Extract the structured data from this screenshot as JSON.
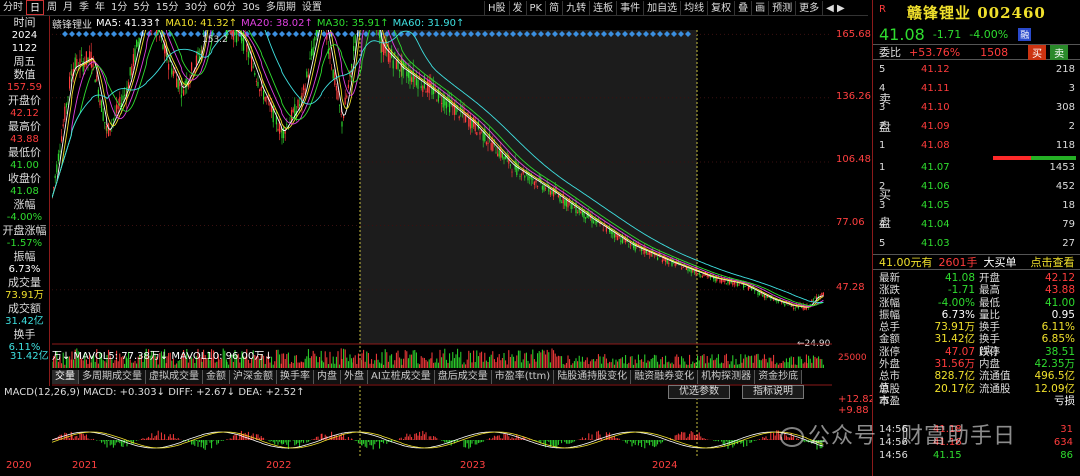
{
  "topbar": {
    "items": [
      "分时",
      "日",
      "周",
      "月",
      "季",
      "年",
      "1分",
      "5分",
      "15分",
      "30分",
      "60分",
      "30s",
      "多周期",
      "设置"
    ],
    "active": "日",
    "right_items": [
      "H股",
      "发",
      "PK",
      "简",
      "九转",
      "连板",
      "事件",
      "加自选",
      "均线",
      "复权",
      "叠",
      "画",
      "预测",
      "更多"
    ]
  },
  "ma": {
    "name": "赣锋锂业",
    "ma5": "MA5: 41.33↑",
    "ma10": "MA10: 41.32↑",
    "ma20": "MA20: 38.02↑",
    "ma30": "MA30: 35.91↑",
    "ma60": "MA60: 31.90↑"
  },
  "left_panel": {
    "time_label": "时间",
    "year": "2024",
    "date": "1122",
    "weekday": "周五",
    "count_label": "数值",
    "count_val": "157.59",
    "open_label": "开盘价",
    "open_val": "42.12",
    "high_label": "最高价",
    "high_val": "43.88",
    "low_label": "最低价",
    "low_val": "41.00",
    "close_label": "收盘价",
    "close_val": "41.08",
    "chg_label": "涨幅",
    "chg_val": "-4.00%",
    "open_chg_label": "开盘涨幅",
    "open_chg_val": "-1.57%",
    "amp_label": "振幅",
    "amp_val": "6.73%",
    "vol_label": "成交量",
    "vol_val": "73.91万",
    "amt_label": "成交额",
    "amt_val": "31.42亿",
    "turn_label": "换手",
    "turn_val": "6.11%"
  },
  "yaxis": [
    "165.68",
    "136.26",
    "106.48",
    "77.06",
    "47.28"
  ],
  "annotations": {
    "high_mark": "153.2",
    "low_mark": "24.90"
  },
  "volume": {
    "line": "万↓ MAVOL5: 77.38万↓ MAVOL10: 96.00万↓",
    "right": "25000"
  },
  "ind_tabs": [
    "交量",
    "多周期成交量",
    "虚拟成交量",
    "金额",
    "沪深金额",
    "换手率",
    "内盘",
    "外盘",
    "AI立桩成交量",
    "盘后成交量",
    "市盈率(ttm)",
    "陆股通持股变化",
    "融资融券变化",
    "机构探测器",
    "资金抄底"
  ],
  "ind_active": "交量",
  "opt_buttons": [
    "优选参数",
    "指标说明"
  ],
  "macd": {
    "line": "MACD(12,26,9) MACD: +0.303↓ DIFF: +2.67↓ DEA: +2.52↑",
    "y1": "+12.82",
    "y2": "+9.88"
  },
  "xaxis": [
    "2020",
    "2021",
    "2022",
    "2023",
    "2024"
  ],
  "right": {
    "r": "R",
    "title": "赣锋锂业 002460",
    "price": "41.08",
    "change": "-1.71",
    "pct": "-4.00%",
    "badge": "融",
    "weibi_label": "委比",
    "weibi_val": "+53.76%",
    "weibi_num": "1508",
    "buy": "买",
    "sell": "卖",
    "sell_side": [
      "卖",
      "盘"
    ],
    "buy_side": [
      "买",
      "盘"
    ],
    "asks": [
      {
        "lvl": "5",
        "price": "41.12",
        "vol": "218"
      },
      {
        "lvl": "4",
        "price": "41.11",
        "vol": "3"
      },
      {
        "lvl": "3",
        "price": "41.10",
        "vol": "308"
      },
      {
        "lvl": "2",
        "price": "41.09",
        "vol": "2"
      },
      {
        "lvl": "1",
        "price": "41.08",
        "vol": "118"
      }
    ],
    "bids": [
      {
        "lvl": "1",
        "price": "41.07",
        "vol": "1453"
      },
      {
        "lvl": "2",
        "price": "41.06",
        "vol": "452"
      },
      {
        "lvl": "3",
        "price": "41.05",
        "vol": "18"
      },
      {
        "lvl": "4",
        "price": "41.04",
        "vol": "79"
      },
      {
        "lvl": "5",
        "price": "41.03",
        "vol": "27"
      }
    ],
    "bigbuy": {
      "price": "41.00元有",
      "vol": "2601手",
      "label": "大买单",
      "link": "点击查看"
    },
    "quote": [
      {
        "l1": "最新",
        "v1": "41.08",
        "c1": "g",
        "l2": "开盘",
        "v2": "42.12",
        "c2": "r"
      },
      {
        "l1": "涨跌",
        "v1": "-1.71",
        "c1": "g",
        "l2": "最高",
        "v2": "43.88",
        "c2": "r"
      },
      {
        "l1": "涨幅",
        "v1": "-4.00%",
        "c1": "g",
        "l2": "最低",
        "v2": "41.00",
        "c2": "g"
      },
      {
        "l1": "振幅",
        "v1": "6.73%",
        "c1": "w",
        "l2": "量比",
        "v2": "0.95",
        "c2": "w"
      },
      {
        "l1": "总手",
        "v1": "73.91万",
        "c1": "y",
        "l2": "换手",
        "v2": "6.11%",
        "c2": "y"
      },
      {
        "l1": "金额",
        "v1": "31.42亿",
        "c1": "y",
        "l2": "换手(实)",
        "v2": "6.85%",
        "c2": "y"
      },
      {
        "l1": "涨停",
        "v1": "47.07",
        "c1": "r",
        "l2": "跌停",
        "v2": "38.51",
        "c2": "g"
      },
      {
        "l1": "外盘",
        "v1": "31.56万",
        "c1": "r",
        "l2": "内盘",
        "v2": "42.35万",
        "c2": "g"
      },
      {
        "l1": "总市值",
        "v1": "828.7亿",
        "c1": "y",
        "l2": "流通值",
        "v2": "496.5亿",
        "c2": "y"
      },
      {
        "l1": "总股本",
        "v1": "20.17亿",
        "c1": "y",
        "l2": "流通股",
        "v2": "12.09亿",
        "c2": "y"
      },
      {
        "l1": "市盈",
        "v1": "",
        "c1": "y",
        "l2": "",
        "v2": "亏损",
        "c2": "w"
      }
    ],
    "ticks": [
      {
        "time": "14:56",
        "price": "41.18",
        "vol": "31",
        "c": "r"
      },
      {
        "time": "14:56",
        "price": "41.16",
        "vol": "634",
        "c": "r"
      },
      {
        "time": "14:56",
        "price": "41.15",
        "vol": "86",
        "c": "g"
      }
    ]
  },
  "watermark": "公众号 · 财富助手日",
  "colors": {
    "up": "#ff3c3c",
    "down": "#2fdc2f",
    "bg": "#000000",
    "ma5": "#ffffff",
    "ma10": "#f0e02c",
    "ma20": "#e040e0",
    "ma30": "#2fdc2f",
    "ma60": "#3ee0e0"
  }
}
